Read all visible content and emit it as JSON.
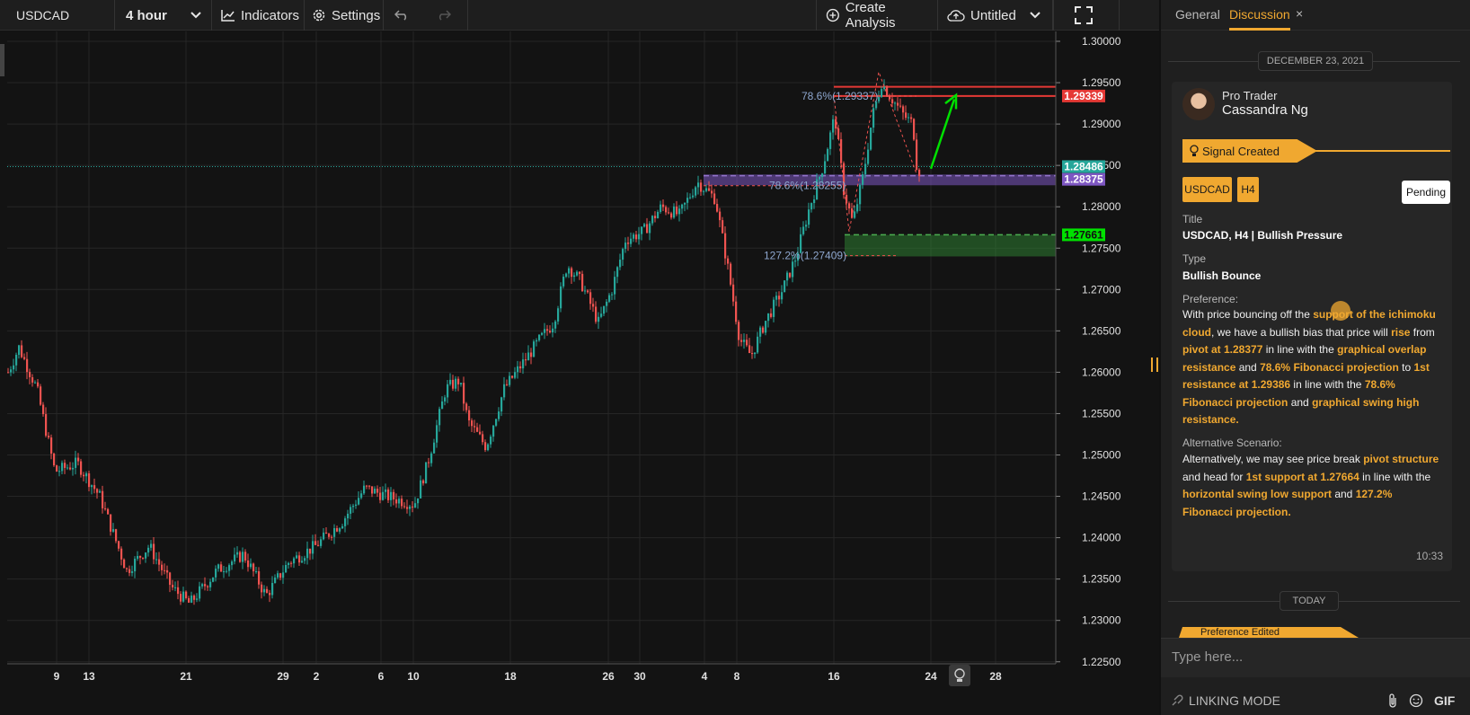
{
  "toolbar": {
    "symbol": "USDCAD",
    "interval": "4 hour",
    "indicators": "Indicators",
    "settings": "Settings",
    "create_analysis": "Create Analysis",
    "layout_name": "Untitled"
  },
  "chart": {
    "y_ticks": [
      "1.30000",
      "1.29500",
      "1.29000",
      "1.28500",
      "1.28000",
      "1.27500",
      "1.27000",
      "1.26500",
      "1.26000",
      "1.25500",
      "1.25000",
      "1.24500",
      "1.24000",
      "1.23500",
      "1.23000",
      "1.22500"
    ],
    "x_ticks": [
      "9",
      "13",
      "21",
      "29",
      "2",
      "6",
      "10",
      "18",
      "26",
      "30",
      "4",
      "8",
      "16",
      "24",
      "28"
    ],
    "price_labels": {
      "red": "1.29339",
      "teal": "1.28486",
      "purple": "1.28375",
      "green": "1.27661"
    },
    "fib_labels": {
      "fib_upper": "78.6%(1.29337)",
      "fib_mid": "78.6%(1.28255)",
      "fib_low": "127.2%(1.27409)"
    },
    "colors": {
      "up": "#26a69a",
      "down": "#ef5350",
      "resistance": "#e53935",
      "pivot": "#7e57c2",
      "support": "#2e7d32",
      "arrow": "#00e000"
    }
  },
  "panel": {
    "tabs": [
      "General",
      "Discussion"
    ],
    "active_tab": "Discussion",
    "close": "×",
    "date_header": "DECEMBER 23, 2021",
    "author_role": "Pro Trader",
    "author_name": "Cassandra Ng",
    "signal": "Signal Created",
    "tags": [
      "USDCAD",
      "H4"
    ],
    "status": "Pending",
    "title_label": "Title",
    "title_value": "USDCAD, H4 | Bullish Pressure",
    "type_label": "Type",
    "type_value": "Bullish Bounce",
    "preference_label": "Preference:",
    "preference": [
      {
        "t": "With price bouncing off the ",
        "h": false
      },
      {
        "t": "support of the ichimoku cloud",
        "h": true
      },
      {
        "t": ",  we have a bullish bias that price will ",
        "h": false
      },
      {
        "t": "rise",
        "h": true
      },
      {
        "t": " from ",
        "h": false
      },
      {
        "t": "pivot at 1.28377",
        "h": true
      },
      {
        "t": " in line with the ",
        "h": false
      },
      {
        "t": "graphical overlap resistance",
        "h": true
      },
      {
        "t": " and  ",
        "h": false
      },
      {
        "t": "78.6% Fibonacci projection",
        "h": true
      },
      {
        "t": " to ",
        "h": false
      },
      {
        "t": "1st resistance at 1.29386",
        "h": true
      },
      {
        "t": " in line with the ",
        "h": false
      },
      {
        "t": "78.6% Fibonacci projection",
        "h": true
      },
      {
        "t": " and ",
        "h": false
      },
      {
        "t": "graphical swing high resistance.",
        "h": true
      }
    ],
    "alternative_label": "Alternative Scenario:",
    "alternative": [
      {
        "t": "Alternatively, we may see price break ",
        "h": false
      },
      {
        "t": "pivot structure",
        "h": true
      },
      {
        "t": " and head for ",
        "h": false
      },
      {
        "t": "1st support at 1.27664",
        "h": true
      },
      {
        "t": " in line with the ",
        "h": false
      },
      {
        "t": "horizontal swing low support",
        "h": true
      },
      {
        "t": " and ",
        "h": false
      },
      {
        "t": "127.2% Fibonacci projection.",
        "h": true
      }
    ],
    "time": "10:33",
    "today_header": "TODAY",
    "edited_banner": "Preference Edited",
    "input_placeholder": "Type here...",
    "linking_mode": "LINKING MODE",
    "gif": "GIF"
  }
}
